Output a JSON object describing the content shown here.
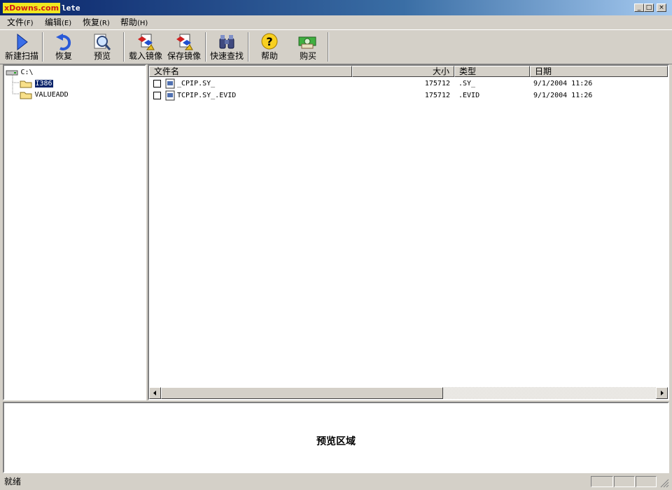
{
  "window": {
    "logo_text": "xDowns.com",
    "title_rest": "lete",
    "minimize": "_",
    "maximize": "□",
    "close": "×"
  },
  "menu": [
    {
      "label": "文件",
      "accel": "(F)"
    },
    {
      "label": "编辑",
      "accel": "(E)"
    },
    {
      "label": "恢复",
      "accel": "(R)"
    },
    {
      "label": "帮助",
      "accel": "(H)"
    }
  ],
  "toolbar": {
    "new_scan": "新建扫描",
    "restore": "恢复",
    "preview": "预览",
    "load_image": "载入镜像",
    "save_image": "保存镜像",
    "quick_find": "快速查找",
    "help": "帮助",
    "buy": "购买"
  },
  "tree": {
    "root": "C:\\",
    "children": [
      "I386",
      "VALUEADD"
    ]
  },
  "list": {
    "columns": [
      "文件名",
      "大小",
      "类型",
      "日期"
    ],
    "rows": [
      {
        "name": "_CPIP.SY_",
        "size": "175712",
        "type": ".SY_",
        "date": "9/1/2004 11:26"
      },
      {
        "name": "TCPIP.SY_.EVID",
        "size": "175712",
        "type": ".EVID",
        "date": "9/1/2004 11:26"
      }
    ]
  },
  "preview": {
    "label": "预览区域"
  },
  "status": {
    "text": "就绪"
  },
  "colors": {
    "title_start": "#0a246a",
    "title_end": "#a6caf0",
    "selection": "#0a246a",
    "face": "#d4d0c8"
  }
}
